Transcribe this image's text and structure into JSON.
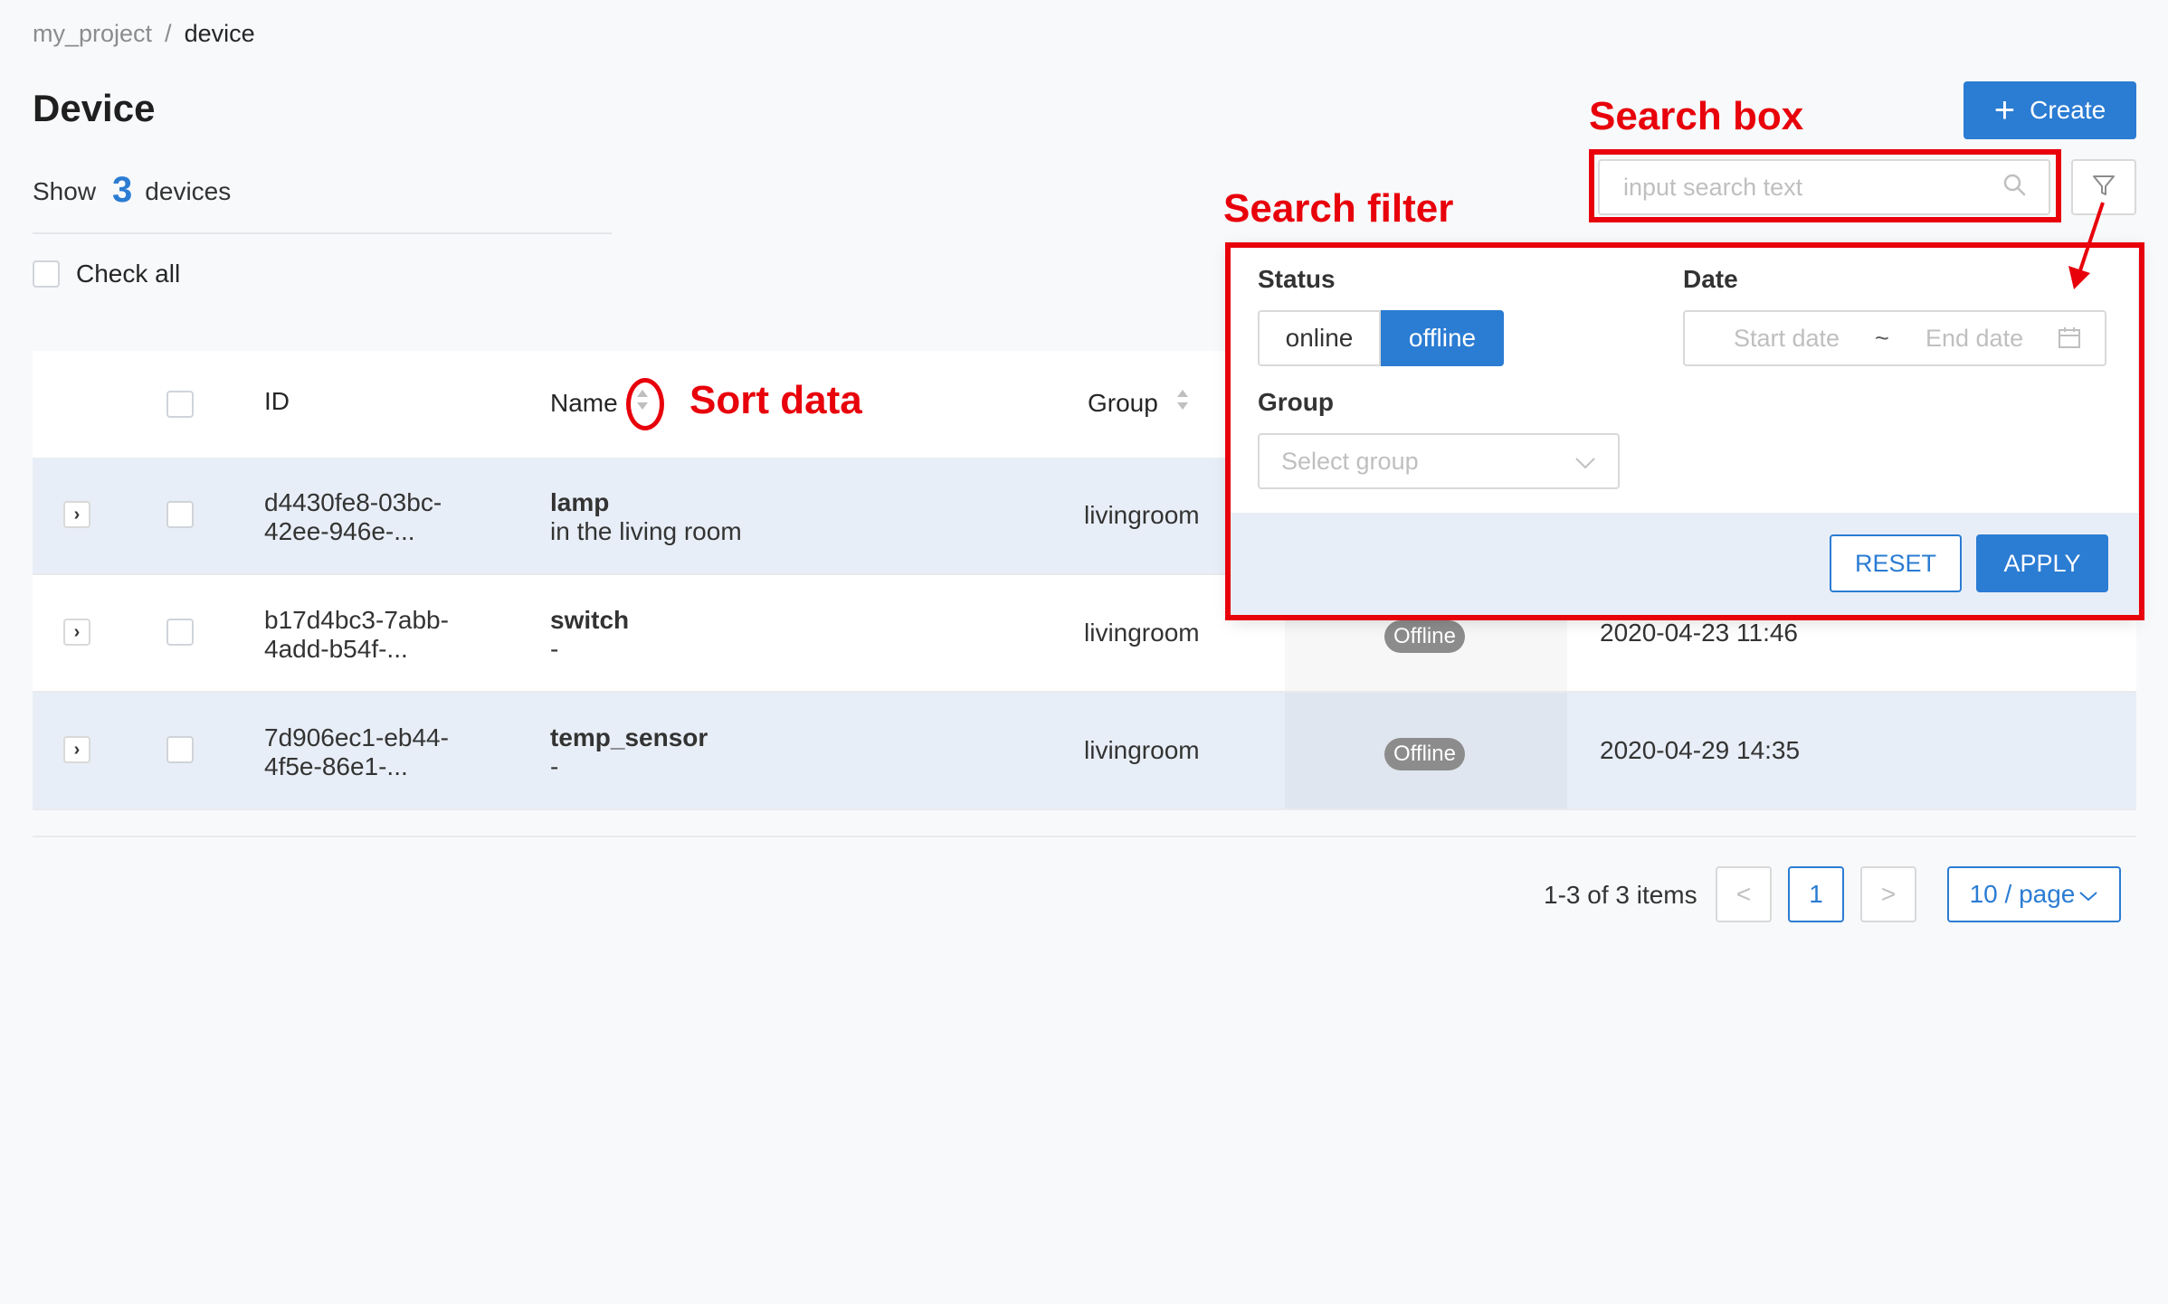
{
  "breadcrumb": {
    "parent": "my_project",
    "separator": "/",
    "current": "device"
  },
  "page": {
    "title": "Device"
  },
  "summary": {
    "prefix": "Show",
    "count": "3",
    "suffix": "devices"
  },
  "check_all_label": "Check all",
  "toolbar": {
    "create_label": "Create",
    "search_placeholder": "input search text"
  },
  "table": {
    "columns": {
      "id": "ID",
      "name": "Name",
      "group": "Group"
    },
    "rows": [
      {
        "id_line1": "d4430fe8-03bc-",
        "id_line2": "42ee-946e-...",
        "name": "lamp",
        "description": "in the living room",
        "group": "livingroom",
        "status": "",
        "date": ""
      },
      {
        "id_line1": "b17d4bc3-7abb-",
        "id_line2": "4add-b54f-...",
        "name": "switch",
        "description": "-",
        "group": "livingroom",
        "status": "Offline",
        "date": "2020-04-23 11:46"
      },
      {
        "id_line1": "7d906ec1-eb44-",
        "id_line2": "4f5e-86e1-...",
        "name": "temp_sensor",
        "description": "-",
        "group": "livingroom",
        "status": "Offline",
        "date": "2020-04-29 14:35"
      }
    ]
  },
  "pagination": {
    "total_text": "1-3 of 3 items",
    "prev": "<",
    "current_page": "1",
    "next": ">",
    "page_size": "10 / page"
  },
  "filter": {
    "status_label": "Status",
    "status_options": [
      "online",
      "offline"
    ],
    "status_selected": "offline",
    "date_label": "Date",
    "start_placeholder": "Start date",
    "range_separator": "~",
    "end_placeholder": "End date",
    "group_label": "Group",
    "group_placeholder": "Select group",
    "reset_label": "RESET",
    "apply_label": "APPLY"
  },
  "annotations": {
    "search_box": "Search box",
    "search_filter": "Search filter",
    "sort_data": "Sort data"
  },
  "colors": {
    "accent": "#2b7cd3",
    "annotation": "#e8000b",
    "row_shade": "#e8eef7"
  }
}
